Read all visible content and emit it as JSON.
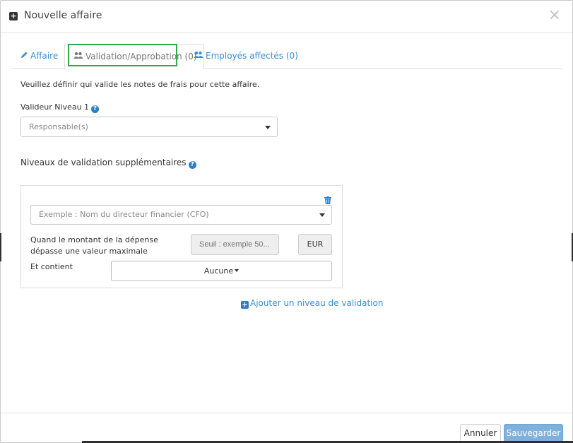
{
  "modal": {
    "title": "Nouvelle affaire",
    "close_symbol": "×",
    "header_icon": "plus-square-icon"
  },
  "tabs": [
    {
      "label": "Affaire",
      "icon": "pencil-icon",
      "active": false
    },
    {
      "label": "Validation/Approbation (0)",
      "icon": "users-icon",
      "active": true
    },
    {
      "label": "Employés affectés (0)",
      "icon": "users-icon",
      "active": false
    }
  ],
  "content": {
    "intro": "Veuillez définir qui valide les notes de frais pour cette affaire.",
    "validator_level1_label": "Valideur Niveau 1",
    "validator_level1_value": "Responsable(s)",
    "extra_levels_label": "Niveaux de validation supplémentaires"
  },
  "level": {
    "approver_placeholder": "Exemple : Nom du directeur financier (CFO)",
    "threshold_label": "Quand le montant de la dépense dépasse une valeur maximale",
    "threshold_placeholder": "Seuil : exemple 50...",
    "currency": "EUR",
    "contains_label": "Et contient",
    "contains_value": "Aucune"
  },
  "add_level_link": "Ajouter un niveau de validation",
  "footer": {
    "cancel_label": "Annuler",
    "save_label": "Sauvegarder"
  },
  "colors": {
    "accent": "#3a8fd1",
    "active_tab_outline": "#2eaa4a",
    "save_button": "#7fb1dc"
  }
}
